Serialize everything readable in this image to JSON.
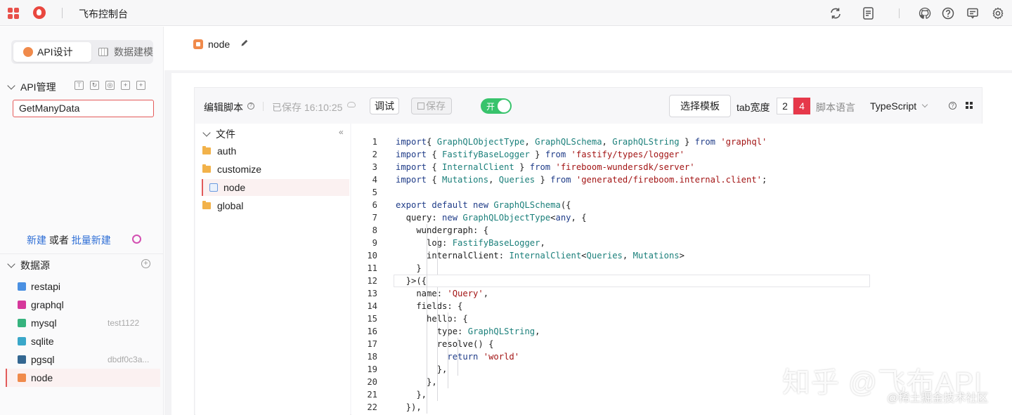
{
  "app": {
    "title": "飞布控制台"
  },
  "topbar": {
    "icons": [
      "apps-grid-icon",
      "logo-icon",
      "refresh-icon",
      "document-icon",
      "github-icon",
      "help-icon",
      "message-icon",
      "settings-icon"
    ]
  },
  "sidebar": {
    "switcher": {
      "active_label": "API设计",
      "inactive_label": "数据建模"
    },
    "api_section": {
      "label": "API管理",
      "tools": [
        "filter",
        "refresh",
        "target",
        "add-folder",
        "add-file"
      ]
    },
    "search": {
      "value": "GetManyData"
    },
    "create_line": {
      "new": "新建",
      "or": " 或者 ",
      "batch_new": "批量新建"
    },
    "datasource_section": {
      "label": "数据源"
    },
    "datasources": [
      {
        "name": "restapi",
        "meta": "",
        "color": "#4a90e2"
      },
      {
        "name": "graphql",
        "meta": "",
        "color": "#d6389b"
      },
      {
        "name": "mysql",
        "meta": "test1122",
        "color": "#36b37e"
      },
      {
        "name": "sqlite",
        "meta": "",
        "color": "#3aa7c9"
      },
      {
        "name": "pgsql",
        "meta": "dbdf0c3a...",
        "color": "#336791"
      },
      {
        "name": "node",
        "meta": "",
        "color": "#f08a4b"
      }
    ]
  },
  "main": {
    "file_tab": {
      "label": "node"
    },
    "toolbar": {
      "edit_script": "编辑脚本",
      "saved_status": "已保存 16:10:25",
      "debug": "调试",
      "save": "保存",
      "toggle_label": "开",
      "choose_template": "选择模板",
      "tab_width_label": "tab宽度",
      "tab_width_options": [
        "2",
        "4"
      ],
      "tab_width_selected": "4",
      "script_lang_label": "脚本语言",
      "script_lang_value": "TypeScript"
    },
    "tree": {
      "root": "文件",
      "items": [
        {
          "name": "auth",
          "type": "folder"
        },
        {
          "name": "customize",
          "type": "folder"
        },
        {
          "name": "node",
          "type": "file"
        },
        {
          "name": "global",
          "type": "folder"
        }
      ]
    },
    "code": {
      "current_line": 12,
      "lines": [
        [
          [
            "kw",
            "import"
          ],
          [
            "",
            "{ "
          ],
          [
            "ty",
            "GraphQLObjectType"
          ],
          [
            "",
            ", "
          ],
          [
            "ty",
            "GraphQLSchema"
          ],
          [
            "",
            ", "
          ],
          [
            "ty",
            "GraphQLString"
          ],
          [
            "",
            " } "
          ],
          [
            "kw",
            "from"
          ],
          [
            "",
            " "
          ],
          [
            "st",
            "'graphql'"
          ]
        ],
        [
          [
            "kw",
            "import"
          ],
          [
            "",
            " { "
          ],
          [
            "ty",
            "FastifyBaseLogger"
          ],
          [
            "",
            " } "
          ],
          [
            "kw",
            "from"
          ],
          [
            "",
            " "
          ],
          [
            "st",
            "'fastify/types/logger'"
          ]
        ],
        [
          [
            "kw",
            "import"
          ],
          [
            "",
            " { "
          ],
          [
            "ty",
            "InternalClient"
          ],
          [
            "",
            " } "
          ],
          [
            "kw",
            "from"
          ],
          [
            "",
            " "
          ],
          [
            "st",
            "'fireboom-wundersdk/server'"
          ]
        ],
        [
          [
            "kw",
            "import"
          ],
          [
            "",
            " { "
          ],
          [
            "ty",
            "Mutations"
          ],
          [
            "",
            ", "
          ],
          [
            "ty",
            "Queries"
          ],
          [
            "",
            " } "
          ],
          [
            "kw",
            "from"
          ],
          [
            "",
            " "
          ],
          [
            "st",
            "'generated/fireboom.internal.client'"
          ],
          [
            "",
            ";"
          ]
        ],
        [],
        [
          [
            "kw",
            "export default new"
          ],
          [
            "",
            " "
          ],
          [
            "ty",
            "GraphQLSchema"
          ],
          [
            "",
            "({"
          ]
        ],
        [
          [
            "",
            "  query: "
          ],
          [
            "kw",
            "new"
          ],
          [
            "",
            " "
          ],
          [
            "ty",
            "GraphQLObjectType"
          ],
          [
            "",
            "<"
          ],
          [
            "kw",
            "any"
          ],
          [
            "",
            ", {"
          ]
        ],
        [
          [
            "",
            "    wundergraph: {"
          ]
        ],
        [
          [
            "",
            "      log: "
          ],
          [
            "ty",
            "FastifyBaseLogger"
          ],
          [
            "",
            ","
          ]
        ],
        [
          [
            "",
            "      internalClient: "
          ],
          [
            "ty",
            "InternalClient"
          ],
          [
            "",
            "<"
          ],
          [
            "ty",
            "Queries"
          ],
          [
            "",
            ", "
          ],
          [
            "ty",
            "Mutations"
          ],
          [
            "",
            ">"
          ]
        ],
        [
          [
            "",
            "    }"
          ]
        ],
        [
          [
            "",
            "  }>({"
          ]
        ],
        [
          [
            "",
            "    name: "
          ],
          [
            "st",
            "'Query'"
          ],
          [
            "",
            ","
          ]
        ],
        [
          [
            "",
            "    fields: {"
          ]
        ],
        [
          [
            "",
            "      hello: {"
          ]
        ],
        [
          [
            "",
            "        type: "
          ],
          [
            "ty",
            "GraphQLString"
          ],
          [
            "",
            ","
          ]
        ],
        [
          [
            "",
            "        resolve() {"
          ]
        ],
        [
          [
            "",
            "          "
          ],
          [
            "kw",
            "return"
          ],
          [
            "",
            " "
          ],
          [
            "st",
            "'world'"
          ]
        ],
        [
          [
            "",
            "        },"
          ]
        ],
        [
          [
            "",
            "      },"
          ]
        ],
        [
          [
            "",
            "    },"
          ]
        ],
        [
          [
            "",
            "  }),"
          ]
        ]
      ]
    }
  },
  "watermark": {
    "main": "知乎 @飞布API",
    "sub": "@稀土掘金技术社区"
  }
}
